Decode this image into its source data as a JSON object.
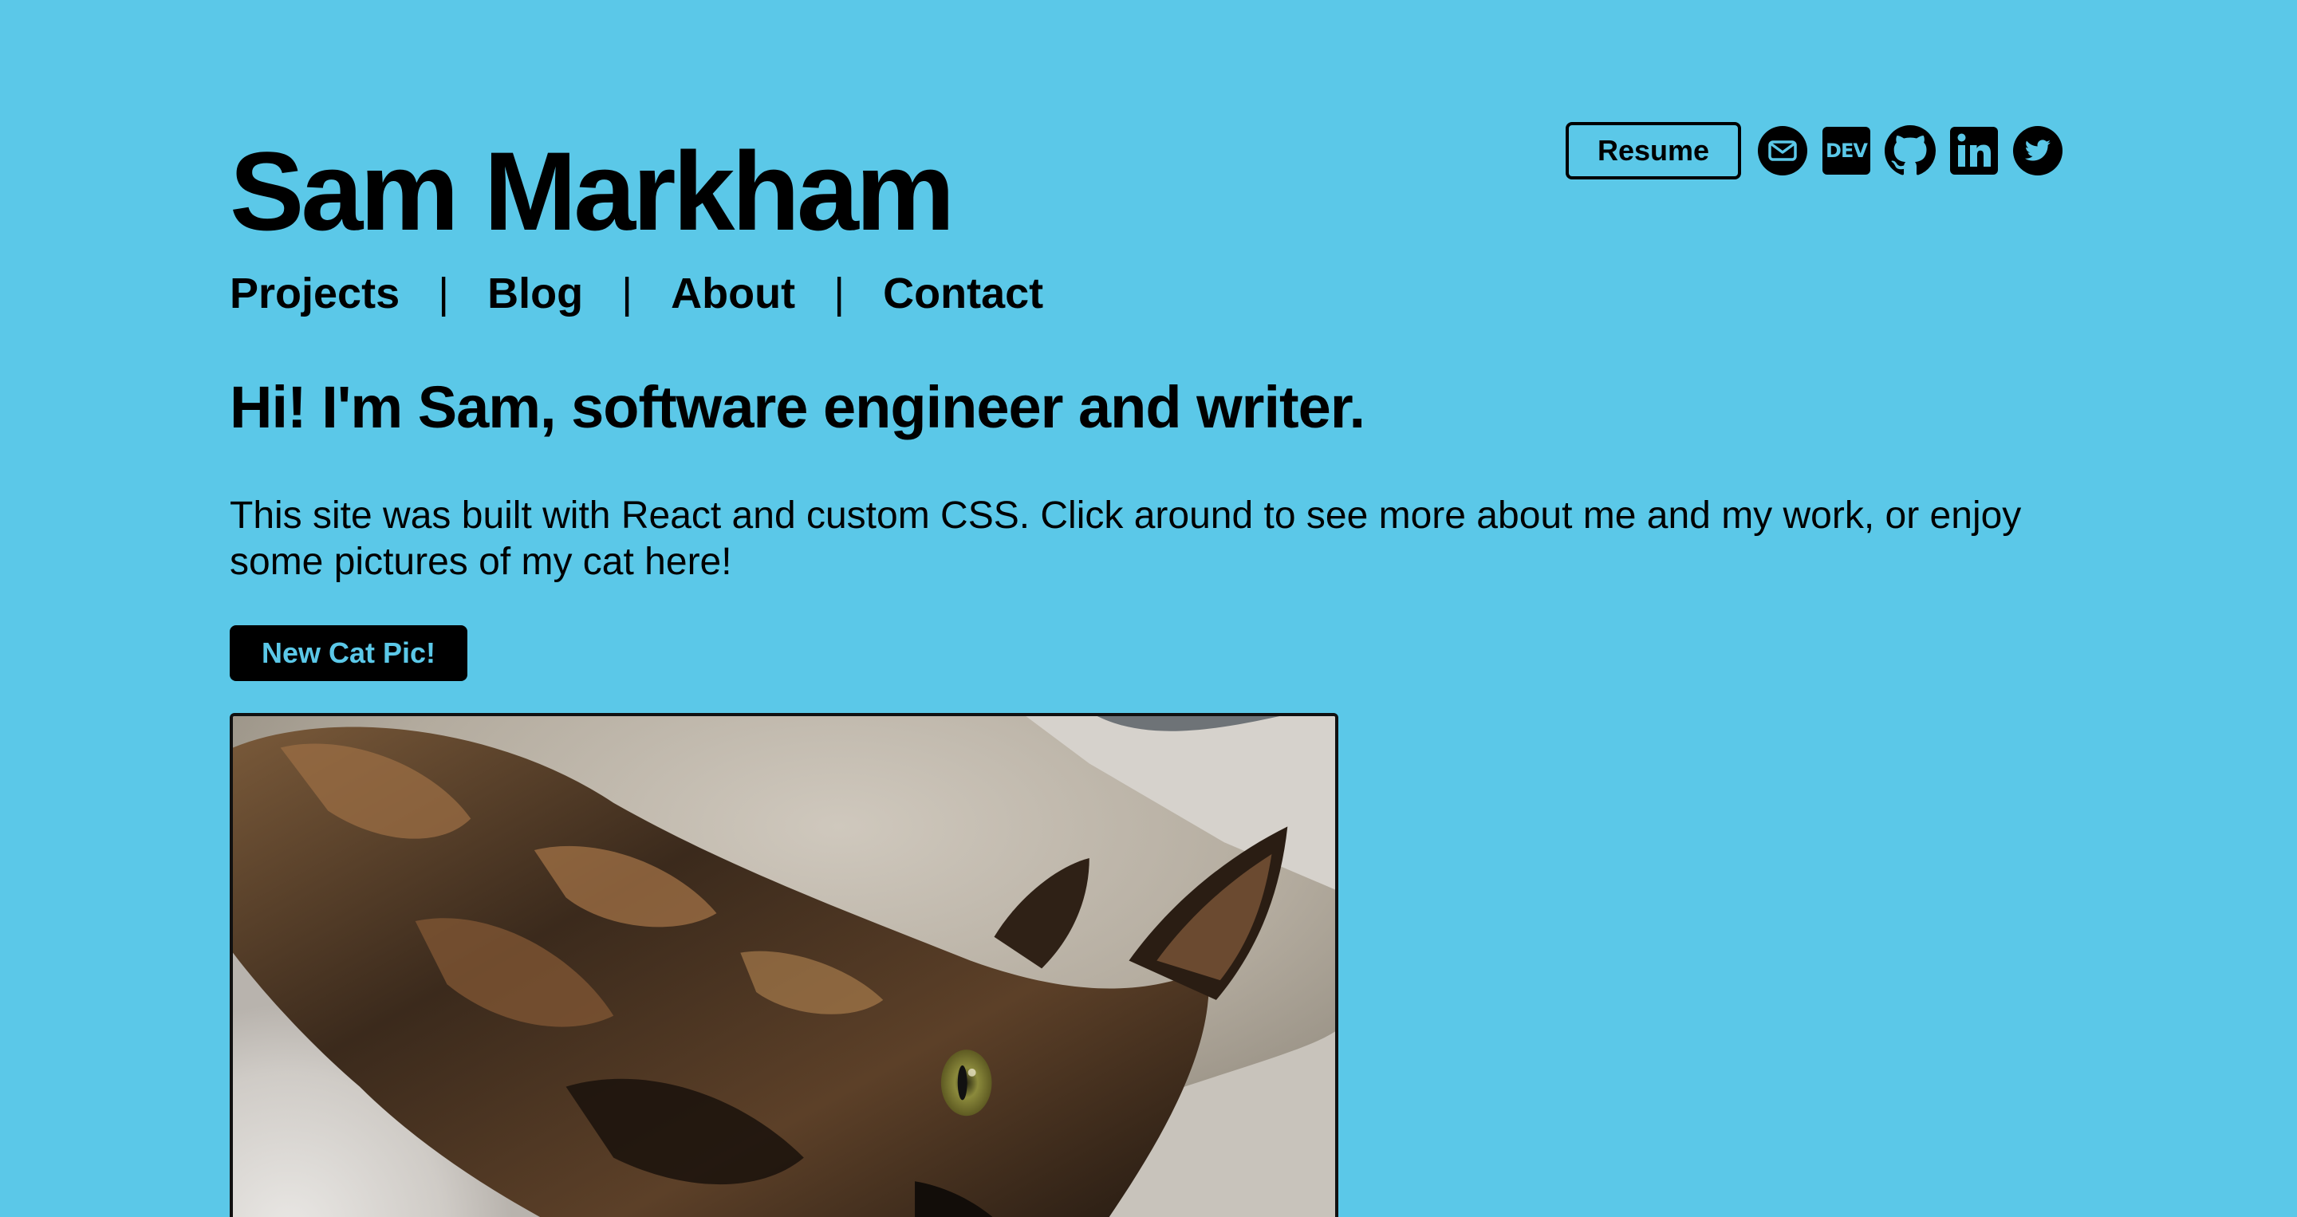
{
  "header": {
    "title": "Sam Markham",
    "resume_label": "Resume",
    "social": [
      {
        "name": "email",
        "icon": "mail-icon"
      },
      {
        "name": "dev",
        "icon": "dev-icon",
        "label": "DEV"
      },
      {
        "name": "github",
        "icon": "github-icon"
      },
      {
        "name": "linkedin",
        "icon": "linkedin-icon",
        "label": "in"
      },
      {
        "name": "twitter",
        "icon": "twitter-icon"
      }
    ]
  },
  "nav": {
    "items": [
      {
        "label": "Projects"
      },
      {
        "label": "Blog"
      },
      {
        "label": "About"
      },
      {
        "label": "Contact"
      }
    ],
    "separator": "|"
  },
  "intro": {
    "heading": "Hi! I'm Sam, software engineer and writer.",
    "text": "This site was built with React and custom CSS. Click around to see more about me and my work, or enjoy some pictures of my cat here!",
    "button_label": "New Cat Pic!"
  },
  "cat_image": {
    "subject": "tortoiseshell cat lying on a gray fuzzy blanket"
  },
  "colors": {
    "background": "#5bc8e8",
    "text": "#000000",
    "button_text": "#5bc8e8"
  }
}
